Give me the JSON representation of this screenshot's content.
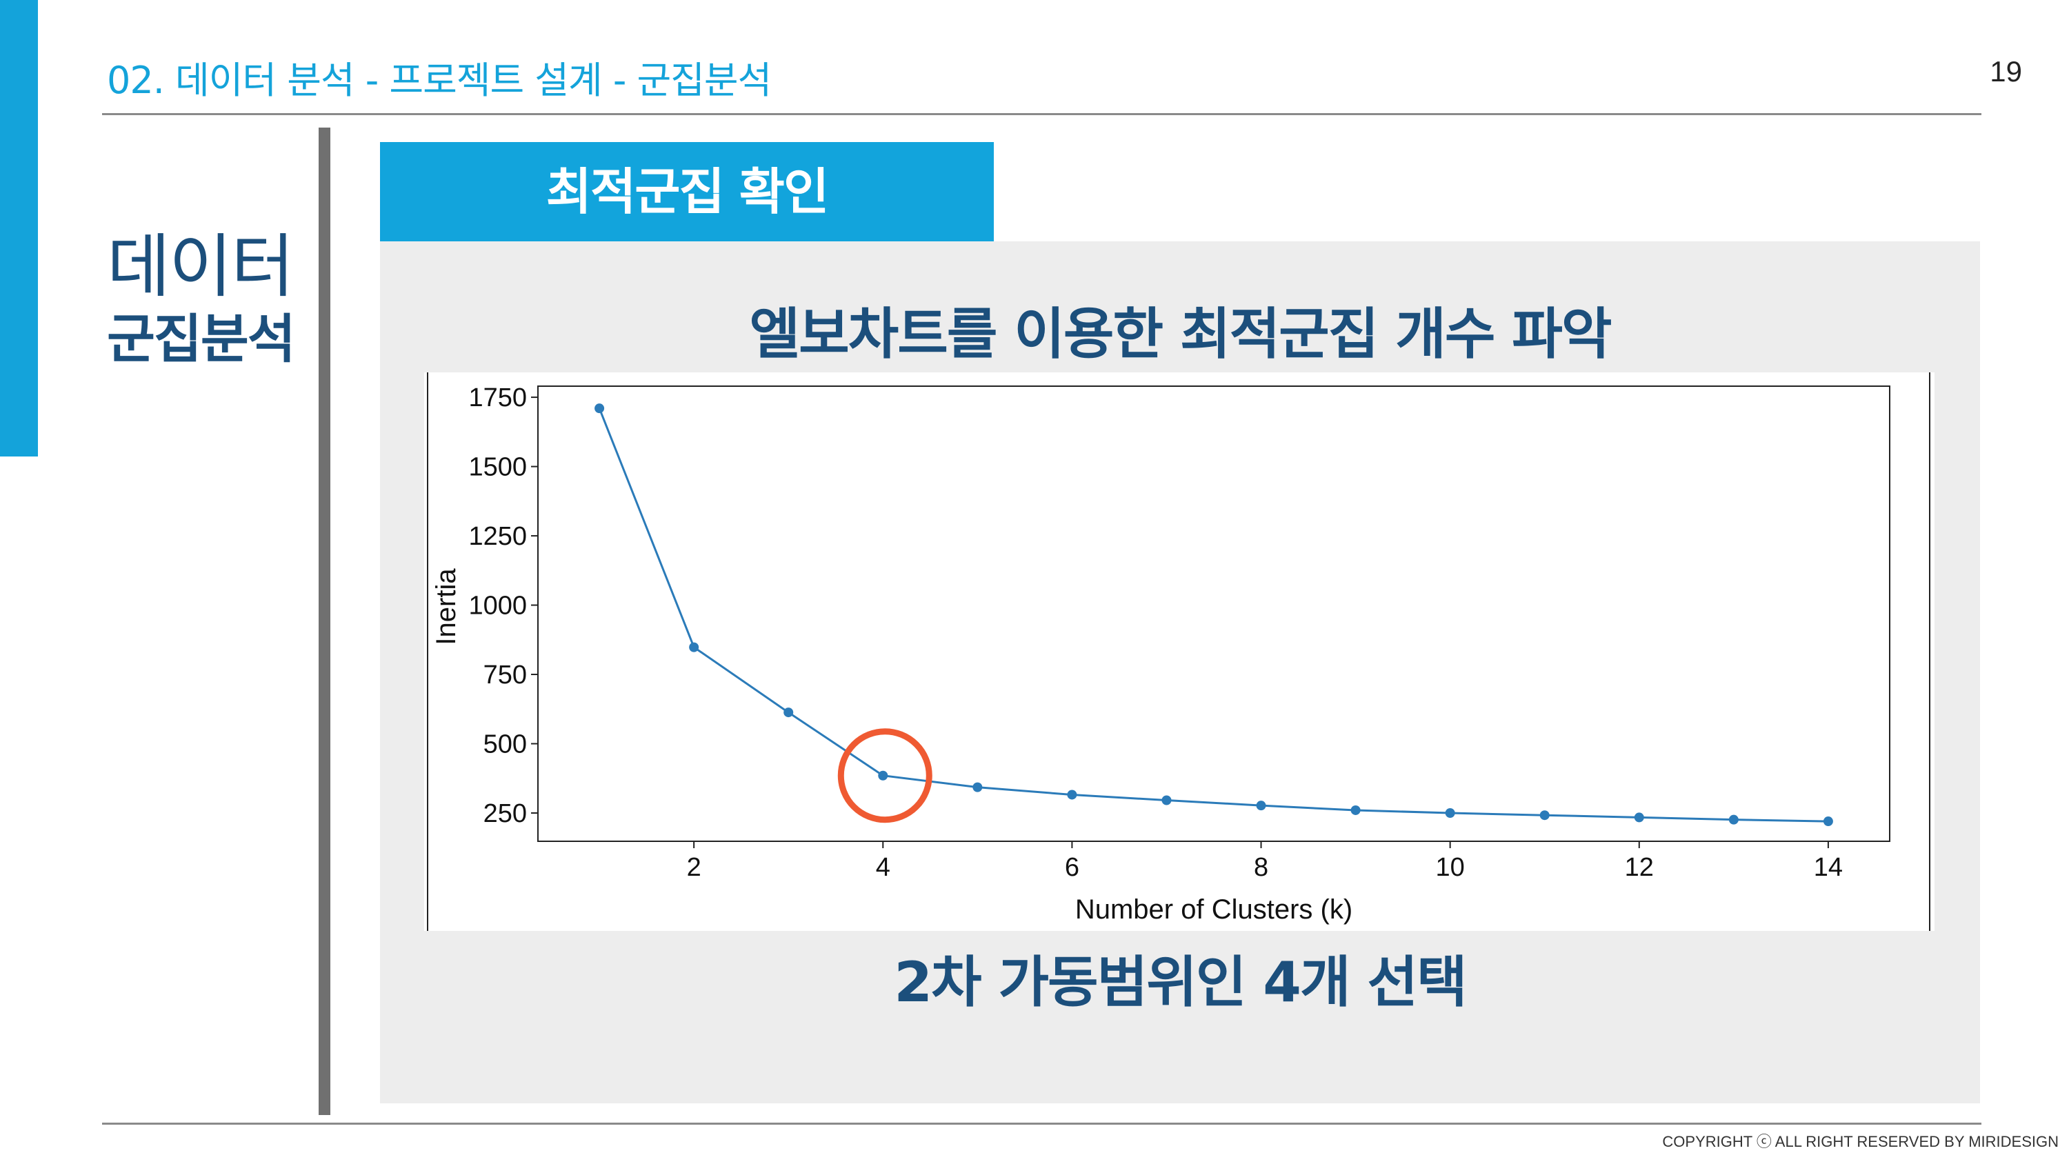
{
  "header": {
    "title": "02. 데이터 분석 - 프로젝트 설계 - 군집분석",
    "page_number": "19"
  },
  "side": {
    "title": "데이터",
    "subtitle": "군집분석"
  },
  "tab": {
    "label": "최적군집 확인"
  },
  "chart_heading": "엘보차트를 이용한 최적군집 개수 파악",
  "conclusion": "2차 가동범위인 4개 선택",
  "footer": {
    "copyright": "COPYRIGHT ⓒ ALL RIGHT RESERVED BY MIRIDESIGN"
  },
  "colors": {
    "accent": "#14a3da",
    "heading": "#1c4f7c",
    "series": "#2b7bb9",
    "highlight": "#ef5a32"
  },
  "chart_data": {
    "type": "line",
    "xlabel": "Number of Clusters (k)",
    "ylabel": "Inertia",
    "x": [
      1,
      2,
      3,
      4,
      5,
      6,
      7,
      8,
      9,
      10,
      11,
      12,
      13,
      14
    ],
    "series": [
      {
        "values": [
          1710,
          848,
          613,
          385,
          343,
          316,
          296,
          277,
          260,
          250,
          242,
          234,
          226,
          220
        ]
      }
    ],
    "xticks": [
      2,
      4,
      6,
      8,
      10,
      12,
      14
    ],
    "yticks": [
      250,
      500,
      750,
      1000,
      1250,
      1500,
      1750
    ],
    "xlim": [
      0.35,
      14.65
    ],
    "ylim": [
      148,
      1790
    ],
    "grid": false,
    "highlight": {
      "x": 4,
      "y": 385,
      "shape": "circle"
    }
  }
}
